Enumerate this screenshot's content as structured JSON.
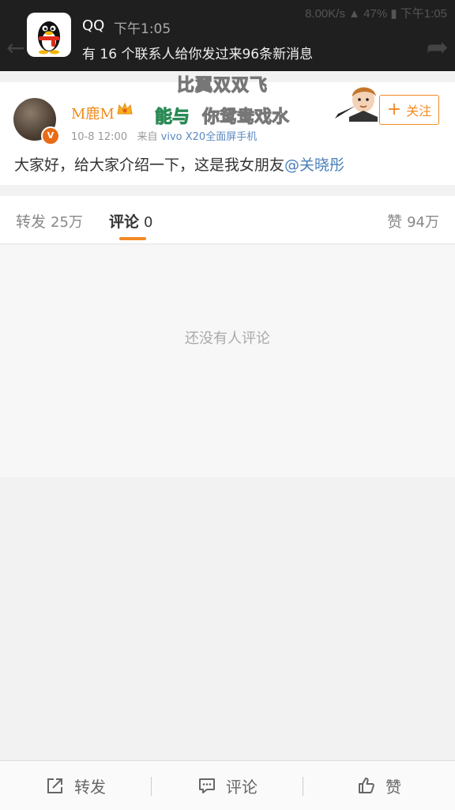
{
  "status_bar": {
    "net_speed": "8.00K/s",
    "battery": "47%",
    "time": "下午1:05"
  },
  "notification": {
    "app_name": "QQ",
    "time": "下午1:05",
    "message": "有 16 个联系人给你发过来96条新消息"
  },
  "overlay_text": {
    "line1": "比翼双双飞",
    "line2_green": "能与",
    "line2_white": "你鸳鸯戏水"
  },
  "post": {
    "username": "M鹿M",
    "date": "10-8 12:00",
    "source_prefix": "来自",
    "device": "vivo X20全面屏手机",
    "text_main": "大家好，给大家介绍一下，这是我女朋友",
    "mention": "@关晓彤",
    "follow_label": "关注"
  },
  "tabs": {
    "repost": {
      "label": "转发",
      "count": "25万"
    },
    "comment": {
      "label": "评论",
      "count": "0"
    },
    "like": {
      "label": "赞",
      "count": "94万"
    }
  },
  "comments": {
    "empty_text": "还没有人评论"
  },
  "toolbar": {
    "repost_label": "转发",
    "comment_label": "评论",
    "like_label": "赞"
  },
  "colors": {
    "accent": "#f28a24",
    "link": "#4a7fb8",
    "overlay_green": "#3ebd76"
  }
}
